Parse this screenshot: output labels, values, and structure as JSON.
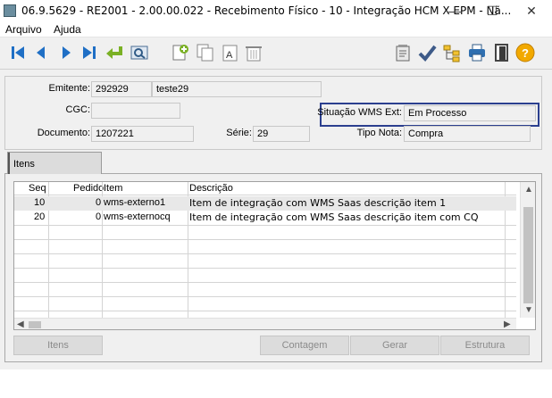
{
  "window": {
    "title": "06.9.5629 - RE2001 - 2.00.00.022 - Recebimento Físico - 10 - Integração HCM X EPM - Nã...",
    "minimize": "—",
    "maximize": "☐",
    "close": "✕"
  },
  "menu": {
    "items": [
      "Arquivo",
      "Ajuda"
    ]
  },
  "toolbar": {
    "icons": [
      "first-icon",
      "prev-icon",
      "next-icon",
      "last-icon",
      "goto-icon",
      "search-icon",
      "add-icon",
      "copy-icon",
      "edit-icon",
      "delete-icon",
      "notes-icon",
      "check-icon",
      "tree-icon",
      "print-icon",
      "exit-icon",
      "help-icon"
    ]
  },
  "header": {
    "emitente_label": "Emitente:",
    "emitente_code": "292929",
    "emitente_name": "teste29",
    "cgc_label": "CGC:",
    "cgc_value": "",
    "wms_label": "Situação WMS Ext:",
    "wms_value": "Em Processo",
    "documento_label": "Documento:",
    "documento_value": "1207221",
    "serie_label": "Série:",
    "serie_value": "29",
    "tipo_label": "Tipo Nota:",
    "tipo_value": "Compra"
  },
  "tabs": [
    {
      "label": "Itens"
    }
  ],
  "grid": {
    "columns": [
      "Seq",
      "Pedido",
      "Item",
      "Descrição"
    ],
    "rows": [
      {
        "seq": "10",
        "pedido": "0",
        "item": "wms-externo1",
        "descricao": "Item de integração com WMS Saas descrição item 1"
      },
      {
        "seq": "20",
        "pedido": "0",
        "item": "wms-externocq",
        "descricao": "Item de integração com WMS Saas descrição item com CQ"
      }
    ]
  },
  "buttons": {
    "itens": "Itens",
    "contagem": "Contagem",
    "gerar": "Gerar",
    "estrutura": "Estrutura"
  },
  "colors": {
    "accent_border": "#2b3f8f",
    "nav_blue": "#1f6fc5",
    "return_green": "#7ab024",
    "help_orange": "#f2a900"
  }
}
